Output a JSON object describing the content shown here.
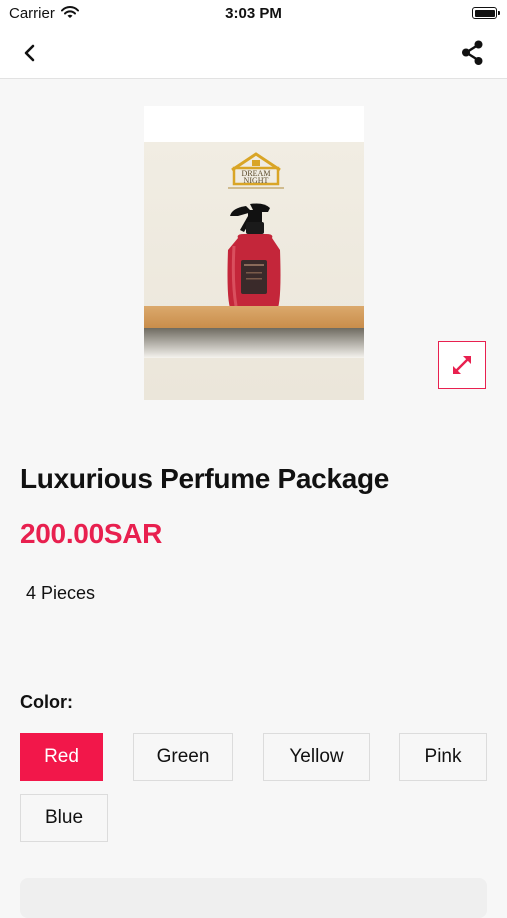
{
  "status_bar": {
    "carrier": "Carrier",
    "time": "3:03 PM"
  },
  "product": {
    "image_logo_text": [
      "DREAM",
      "NIGHT"
    ],
    "title": "Luxurious Perfume Package",
    "price": "200.00SAR",
    "description": "4 Pieces"
  },
  "color": {
    "label": "Color:",
    "options": [
      "Red",
      "Green",
      "Yellow",
      "Pink",
      "Blue"
    ],
    "selected": "Red"
  },
  "icons": {
    "back": "chevron-left-icon",
    "share": "share-icon",
    "expand": "expand-icon"
  },
  "colors": {
    "accent": "#f2174a",
    "border": "#dcdcdc",
    "background": "#f7f7f7"
  }
}
